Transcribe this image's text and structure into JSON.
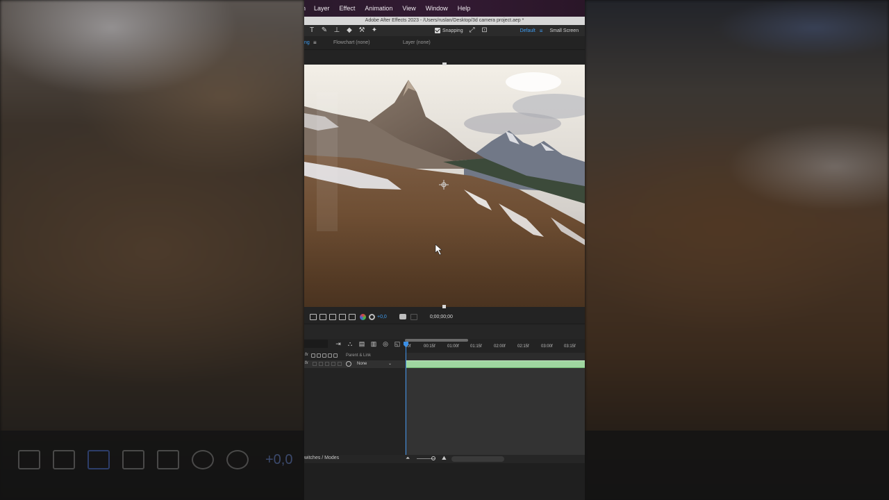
{
  "menu": {
    "items": [
      "n",
      "Layer",
      "Effect",
      "Animation",
      "View",
      "Window",
      "Help"
    ]
  },
  "window": {
    "title": "Adobe After Effects 2023 - /Users/ruslan/Desktop/3d camera project.aep *"
  },
  "toolbar": {
    "tools": [
      "type-tool-icon",
      "brush-tool-icon",
      "clone-stamp-tool-icon",
      "eraser-tool-icon",
      "roto-brush-tool-icon",
      "puppet-pin-tool-icon"
    ],
    "snapping_label": "Snapping",
    "snapping_checked": true,
    "workspace_active": "Default",
    "workspace_other": "Small Screen"
  },
  "panels": {
    "active_tab_fragment": "ng",
    "flowchart_tab": "Flowchart (none)",
    "layer_tab": "Layer (none)"
  },
  "viewer": {
    "exposure": "+0,0",
    "timecode": "0;00;00;00"
  },
  "timeline": {
    "ruler_ticks": [
      "00f",
      "00:15f",
      "01:00f",
      "01:15f",
      "02:00f",
      "02:15f",
      "03:00f",
      "03:15f"
    ],
    "column_parent": "Parent & Link",
    "layer": {
      "parent_value": "None"
    },
    "footer_label": "witches / Modes"
  },
  "colors": {
    "accent": "#3f9cf0",
    "menubar": "#331a33",
    "layer_bar": "#9fd6a0",
    "cti": "#3b8fe6"
  },
  "background": {
    "exposure": "+0,0"
  }
}
